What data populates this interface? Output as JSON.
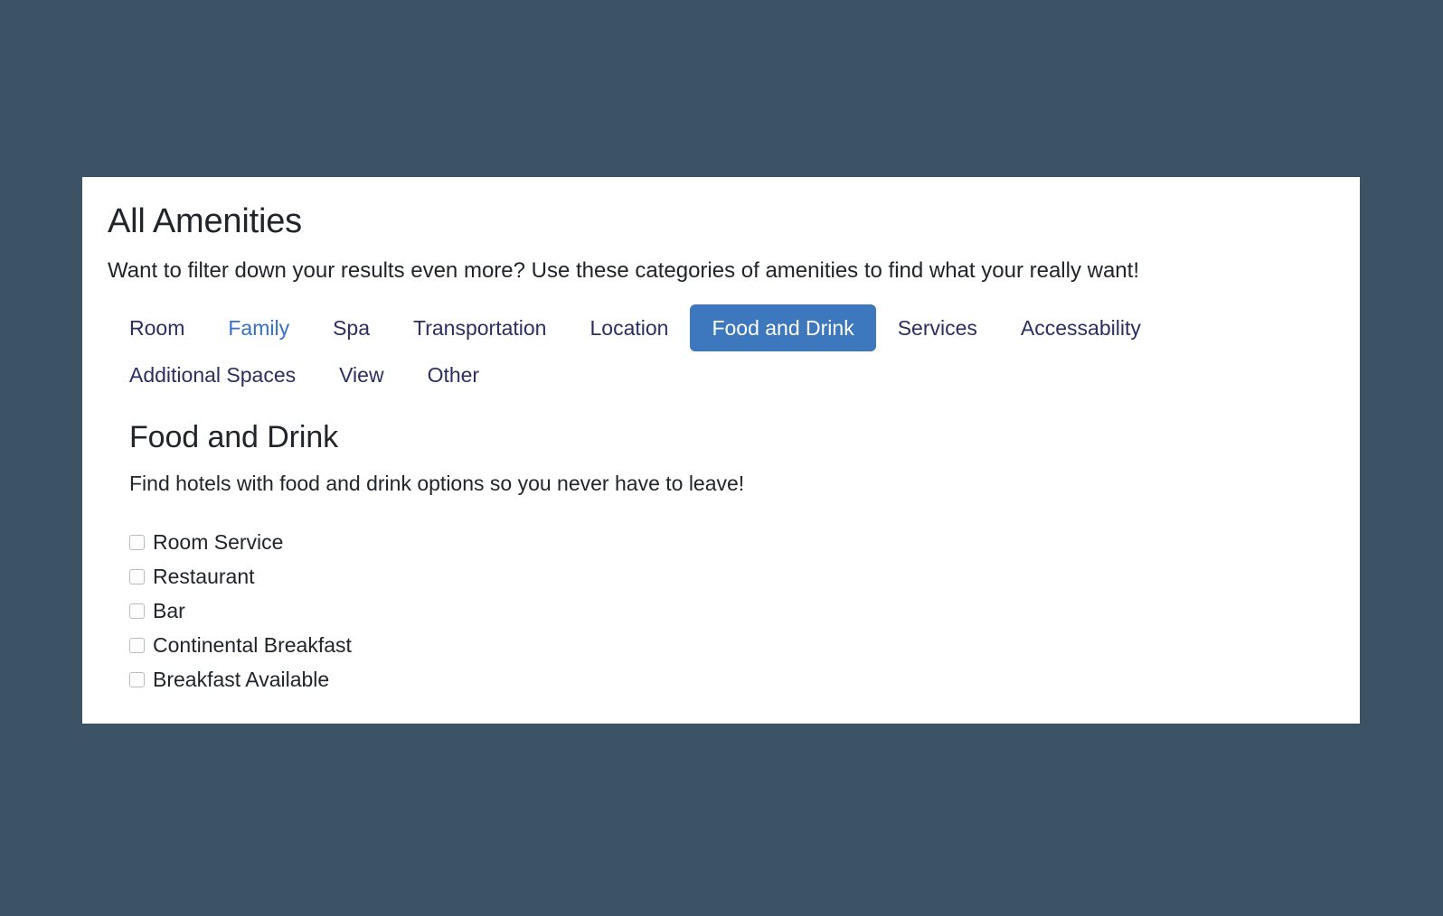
{
  "theme": {
    "page_background": "#3c5366",
    "card_background": "#ffffff",
    "tab_link_color": "#2b2e62",
    "tab_hover_color": "#3670c8",
    "tab_active_background": "#3d77bd",
    "tab_active_text": "#ffffff",
    "text_color": "#212529",
    "checkbox_border": "#bcbcbc"
  },
  "card": {
    "title": "All Amenities",
    "subtitle": "Want to filter down your results even more? Use these categories of amenities to find what your really want!"
  },
  "tabs": [
    {
      "label": "Room",
      "state": "default"
    },
    {
      "label": "Family",
      "state": "hover"
    },
    {
      "label": "Spa",
      "state": "default"
    },
    {
      "label": "Transportation",
      "state": "default"
    },
    {
      "label": "Location",
      "state": "default"
    },
    {
      "label": "Food and Drink",
      "state": "active"
    },
    {
      "label": "Services",
      "state": "default"
    },
    {
      "label": "Accessability",
      "state": "default"
    },
    {
      "label": "Additional Spaces",
      "state": "default"
    },
    {
      "label": "View",
      "state": "default"
    },
    {
      "label": "Other",
      "state": "default"
    }
  ],
  "section": {
    "title": "Food and Drink",
    "description": "Find hotels with food and drink options so you never have to leave!",
    "amenities": [
      {
        "label": "Room Service",
        "checked": false
      },
      {
        "label": "Restaurant",
        "checked": false
      },
      {
        "label": "Bar",
        "checked": false
      },
      {
        "label": "Continental Breakfast",
        "checked": false
      },
      {
        "label": "Breakfast Available",
        "checked": false
      }
    ]
  }
}
